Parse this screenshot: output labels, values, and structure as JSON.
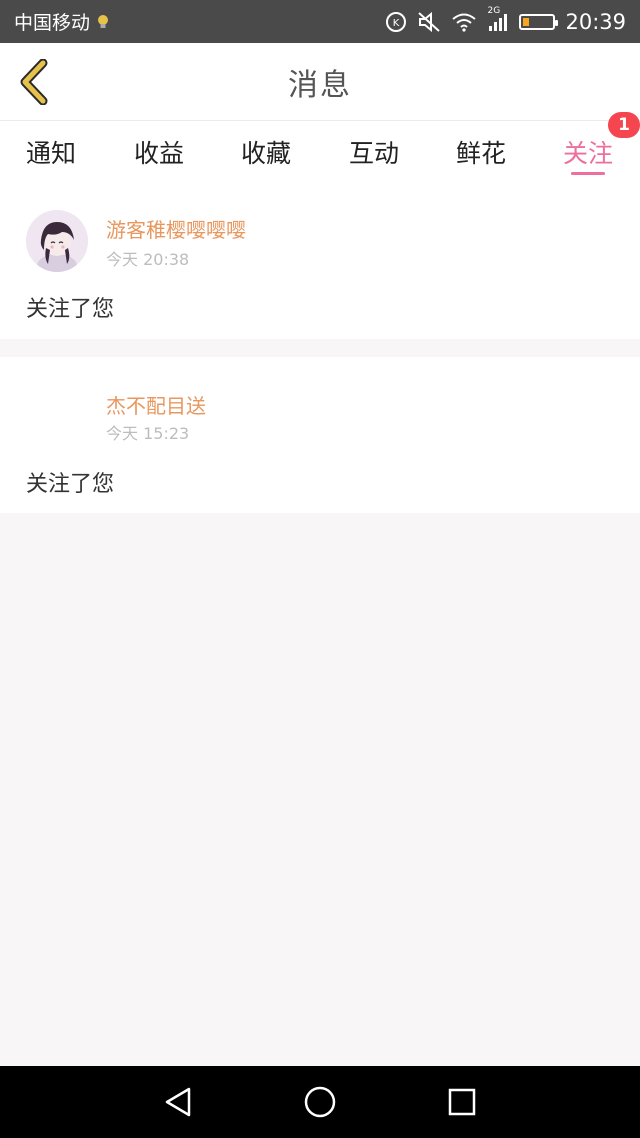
{
  "status_bar": {
    "carrier": "中国移动",
    "network": "2G",
    "time": "20:39",
    "battery_level": 0.2,
    "icons": [
      "bulb-icon",
      "data-speed-icon",
      "mute-icon",
      "wifi-icon",
      "signal-icon",
      "battery-icon"
    ]
  },
  "header": {
    "title": "消息",
    "back_icon": "chevron-left-icon"
  },
  "tabs": [
    {
      "label": "通知",
      "active": false
    },
    {
      "label": "收益",
      "active": false
    },
    {
      "label": "收藏",
      "active": false
    },
    {
      "label": "互动",
      "active": false
    },
    {
      "label": "鲜花",
      "active": false
    },
    {
      "label": "关注",
      "active": true,
      "badge": "1"
    }
  ],
  "messages": [
    {
      "username": "游客稚樱嘤嘤嘤",
      "time": "今天 20:38",
      "content": "关注了您",
      "has_avatar": true
    },
    {
      "username": "杰不配目送",
      "time": "今天 15:23",
      "content": "关注了您",
      "has_avatar": false
    }
  ],
  "colors": {
    "accent": "#ee6f9d",
    "username": "#e8975e",
    "badge": "#f5454f",
    "back_arrow": "#e6c24a"
  },
  "navigation": {
    "icons": [
      "back-triangle-icon",
      "home-circle-icon",
      "recents-square-icon"
    ]
  }
}
